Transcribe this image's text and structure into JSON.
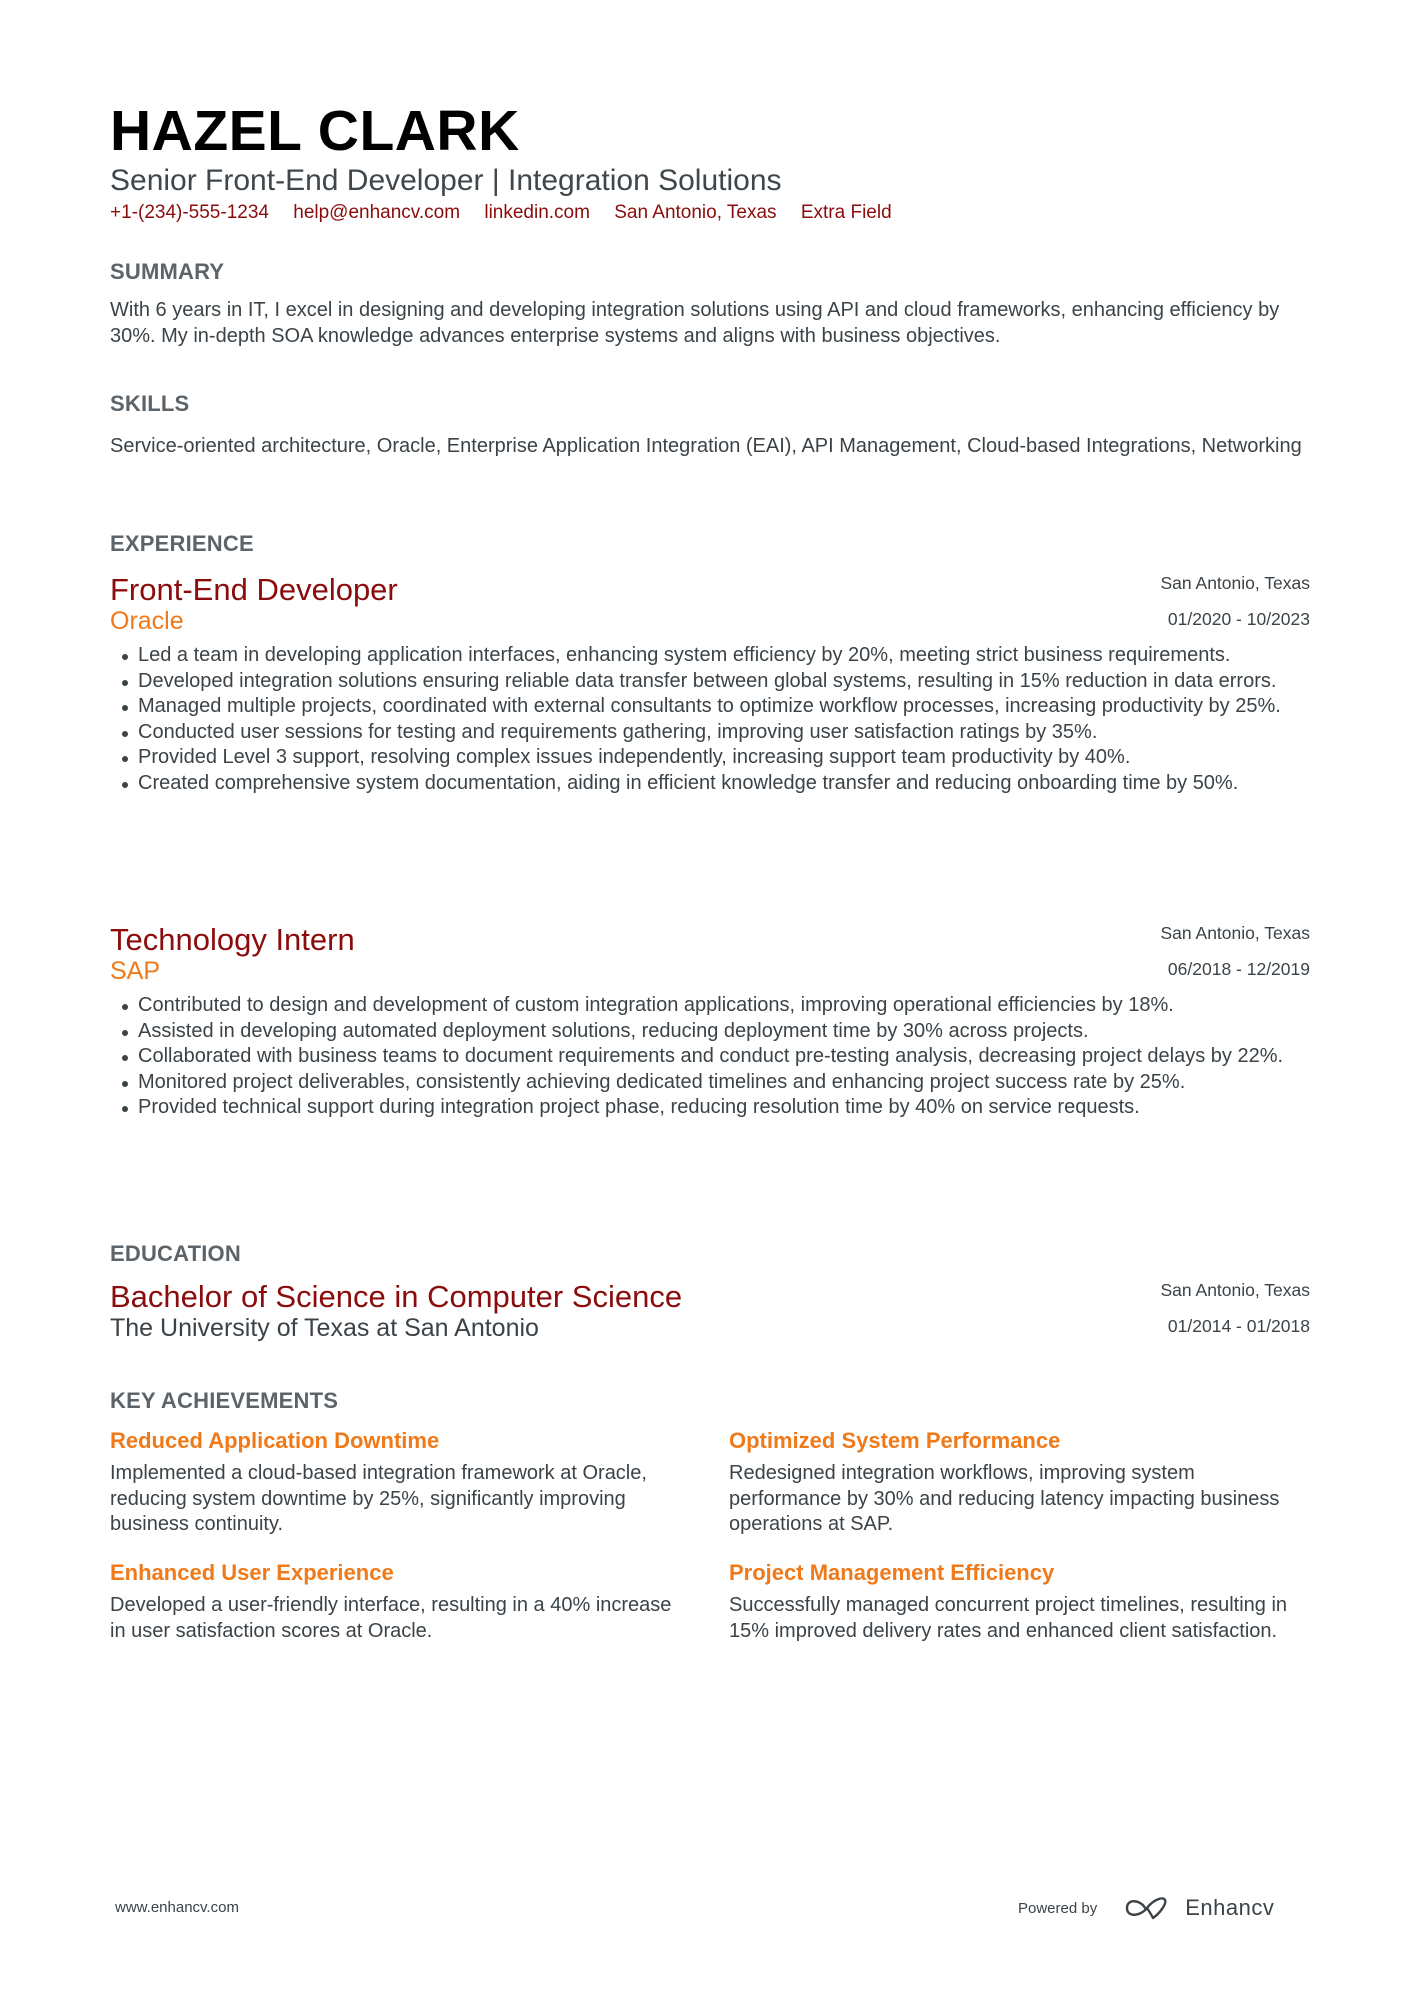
{
  "header": {
    "name": "HAZEL CLARK",
    "title": "Senior Front-End Developer | Integration Solutions",
    "contacts": [
      "+1-(234)-555-1234",
      "help@enhancv.com",
      "linkedin.com",
      "San Antonio, Texas",
      "Extra Field"
    ]
  },
  "summary": {
    "title": "SUMMARY",
    "text": "With 6 years in IT, I excel in designing and developing integration solutions using API and cloud frameworks, enhancing efficiency by 30%. My in-depth SOA knowledge advances enterprise systems and aligns with business objectives."
  },
  "skills": {
    "title": "SKILLS",
    "text": "Service-oriented architecture, Oracle, Enterprise Application Integration (EAI), API Management, Cloud-based Integrations, Networking"
  },
  "experience": {
    "title": "EXPERIENCE",
    "jobs": [
      {
        "role": "Front-End Developer",
        "company": "Oracle",
        "location": "San Antonio, Texas",
        "dates": "01/2020 - 10/2023",
        "bullets": [
          "Led a team in developing application interfaces, enhancing system efficiency by 20%, meeting strict business requirements.",
          "Developed integration solutions ensuring reliable data transfer between global systems, resulting in 15% reduction in data errors.",
          "Managed multiple projects, coordinated with external consultants to optimize workflow processes, increasing productivity by 25%.",
          "Conducted user sessions for testing and requirements gathering, improving user satisfaction ratings by 35%.",
          "Provided Level 3 support, resolving complex issues independently, increasing support team productivity by 40%.",
          "Created comprehensive system documentation, aiding in efficient knowledge transfer and reducing onboarding time by 50%."
        ]
      },
      {
        "role": "Technology Intern",
        "company": "SAP",
        "location": "San Antonio, Texas",
        "dates": "06/2018 - 12/2019",
        "bullets": [
          "Contributed to design and development of custom integration applications, improving operational efficiencies by 18%.",
          "Assisted in developing automated deployment solutions, reducing deployment time by 30% across projects.",
          "Collaborated with business teams to document requirements and conduct pre-testing analysis, decreasing project delays by 22%.",
          "Monitored project deliverables, consistently achieving dedicated timelines and enhancing project success rate by 25%.",
          "Provided technical support during integration project phase, reducing resolution time by 40% on service requests."
        ]
      }
    ]
  },
  "education": {
    "title": "EDUCATION",
    "degree": "Bachelor of Science in Computer Science",
    "school": "The University of Texas at San Antonio",
    "location": "San Antonio, Texas",
    "dates": "01/2014 - 01/2018"
  },
  "achievements": {
    "title": "KEY ACHIEVEMENTS",
    "items": [
      {
        "title": "Reduced Application Downtime",
        "text": "Implemented a cloud-based integration framework at Oracle, reducing system downtime by 25%, significantly improving business continuity."
      },
      {
        "title": "Optimized System Performance",
        "text": "Redesigned integration workflows, improving system performance by 30% and reducing latency impacting business operations at SAP."
      },
      {
        "title": "Enhanced User Experience",
        "text": "Developed a user-friendly interface, resulting in a 40% increase in user satisfaction scores at Oracle."
      },
      {
        "title": "Project Management Efficiency",
        "text": "Successfully managed concurrent project timelines, resulting in 15% improved delivery rates and enhanced client satisfaction."
      }
    ]
  },
  "footer": {
    "website": "www.enhancv.com",
    "powered_by": "Powered by",
    "brand": "Enhancv",
    "brand_icon": "enhancv-logo-icon"
  },
  "colors": {
    "accent_dark_red": "#8a0c0c",
    "accent_orange": "#f07a1a",
    "text": "#3b4348",
    "section_heading": "#5d6469"
  }
}
